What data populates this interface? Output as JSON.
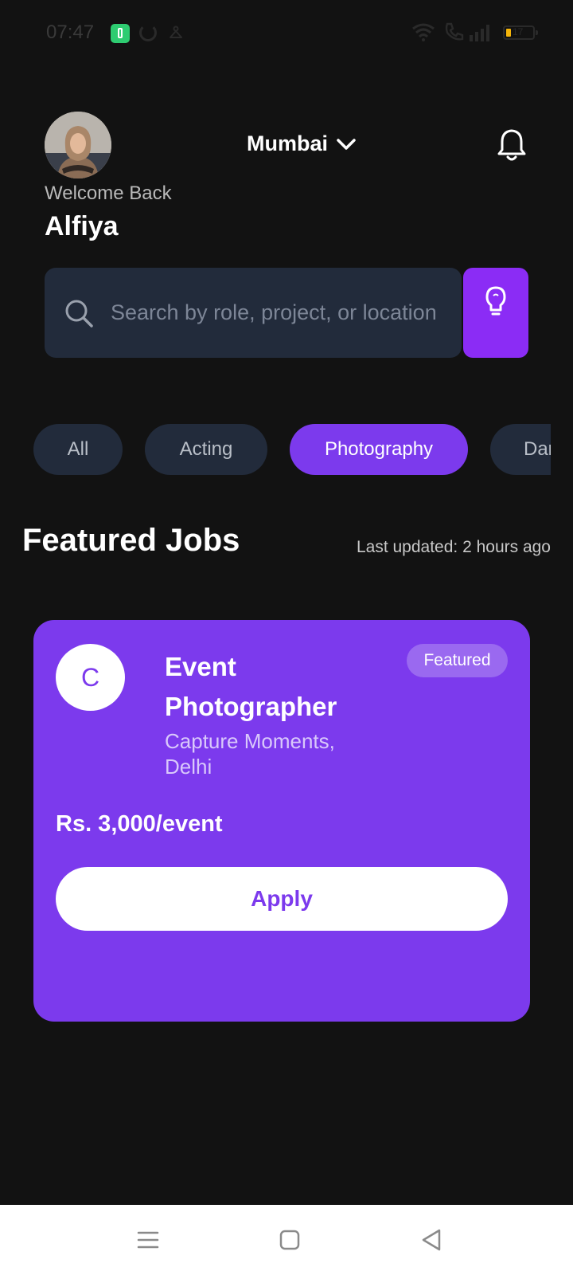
{
  "status_bar": {
    "time": "07:47",
    "battery": "17"
  },
  "header": {
    "welcome": "Welcome Back",
    "username": "Alfiya",
    "location": "Mumbai"
  },
  "search": {
    "placeholder": "Search by role, project, or location"
  },
  "categories": [
    "All",
    "Acting",
    "Photography",
    "Dar"
  ],
  "featured": {
    "title": "Featured Jobs",
    "last_updated": "Last updated: 2 hours ago"
  },
  "job_card": {
    "logo_letter": "C",
    "title": "Event Photographer",
    "company": "Capture Moments, Delhi",
    "badge": "Featured",
    "salary": "Rs. 3,000/event",
    "apply_label": "Apply"
  },
  "colors": {
    "accent": "#7c3aed",
    "background": "#121212",
    "surface": "#222b3b"
  }
}
